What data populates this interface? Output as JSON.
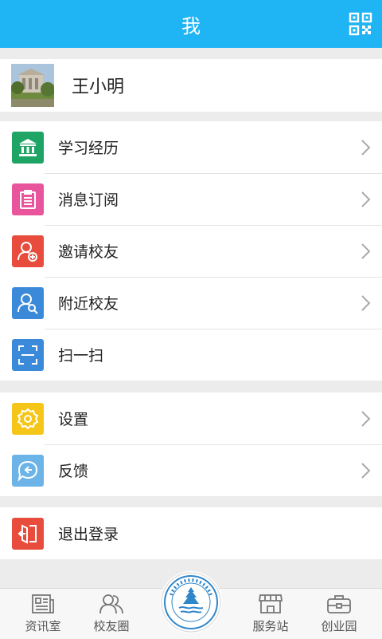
{
  "header": {
    "title": "我"
  },
  "profile": {
    "name": "王小明"
  },
  "menu_group1": [
    {
      "label": "学习经历",
      "icon": "bank-icon",
      "color": "#1ea464"
    },
    {
      "label": "消息订阅",
      "icon": "clipboard-icon",
      "color": "#e8559c"
    },
    {
      "label": "邀请校友",
      "icon": "add-user-icon",
      "color": "#e74c3c"
    },
    {
      "label": "附近校友",
      "icon": "search-user-icon",
      "color": "#3b8ad9"
    },
    {
      "label": "扫一扫",
      "icon": "scan-icon",
      "color": "#3b8ad9"
    }
  ],
  "menu_group2": [
    {
      "label": "设置",
      "icon": "gear-icon",
      "color": "#f5c518"
    },
    {
      "label": "反馈",
      "icon": "feedback-icon",
      "color": "#6cb4e8"
    }
  ],
  "menu_group3": [
    {
      "label": "退出登录",
      "icon": "logout-icon",
      "color": "#e74c3c"
    }
  ],
  "tabbar": {
    "tabs": [
      {
        "label": "资讯室",
        "icon": "newspaper-icon"
      },
      {
        "label": "校友圈",
        "icon": "people-icon"
      },
      {
        "label": "服务站",
        "icon": "shop-icon"
      },
      {
        "label": "创业园",
        "icon": "briefcase-icon"
      }
    ],
    "center_logo": "school-logo"
  }
}
